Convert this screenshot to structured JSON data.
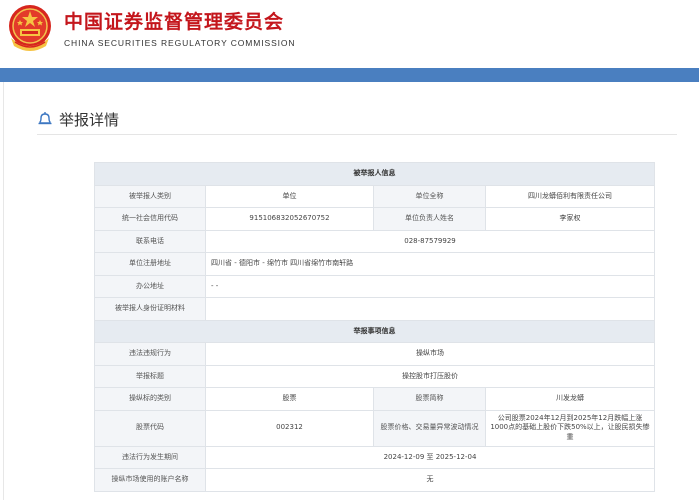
{
  "header": {
    "org_name_cn": "中国证券监督管理委员会",
    "org_name_en": "CHINA SECURITIES REGULATORY COMMISSION"
  },
  "page": {
    "title": "举报详情"
  },
  "reported_party": {
    "section_title": "被举报人信息",
    "type_label": "被举报人类别",
    "type_value": "单位",
    "fullname_label": "单位全称",
    "fullname_value": "四川龙蟒佰利有限责任公司",
    "credit_code_label": "统一社会信用代码",
    "credit_code_value": "91510683205267075​2",
    "leader_label": "单位负责人姓名",
    "leader_value": "李家权",
    "phone_label": "联系电话",
    "phone_value": "028-87579929",
    "address_label": "单位注册地址",
    "address_value": "四川省 - 德阳市 - 绵竹市 四川省绵竹市南轩路",
    "office_label": "办公地址",
    "office_value": "- -",
    "id_material_label": "被举报人身份证明材料",
    "id_material_value": ""
  },
  "report_matter": {
    "section_title": "举报事项信息",
    "violation_label": "违法违规行为",
    "violation_value": "操纵市场",
    "subject_label": "举报标题",
    "subject_value": "操控股市打压股价",
    "target_type_label": "操纵标的类别",
    "target_type_value": "股票",
    "stock_name_label": "股票简称",
    "stock_name_value": "川发龙蟒",
    "stock_code_label": "股票代码",
    "stock_code_value": "002312",
    "anomaly_label": "股票价格、交易量异常波动情况",
    "anomaly_value": "公司股票2024年12月到2025年12月跌幅上涨1000点的基础上股价下跌50%以上，让股民损失惨重",
    "period_label": "违法行为发生期间",
    "period_value": "2024-12-09 至 2025-12-04",
    "account_label": "操纵市场使用的账户名称",
    "account_value": "无"
  }
}
